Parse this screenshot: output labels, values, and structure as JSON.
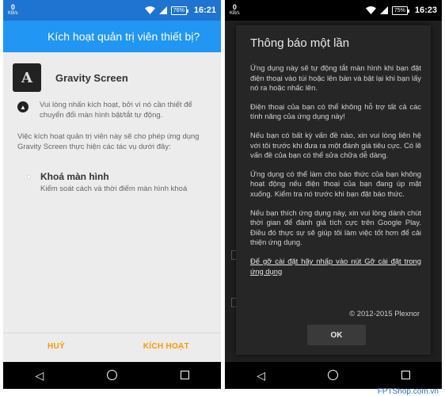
{
  "left": {
    "status": {
      "kbs_value": "0",
      "kbs_unit": "KB/s",
      "battery": "76%",
      "time": "16:21"
    },
    "header": {
      "title": "Kích hoạt quản trị viên thiết bị?"
    },
    "app": {
      "icon_letter": "A",
      "name": "Gravity Screen"
    },
    "info_text": "Vui lòng nhấn kích hoạt, bởi vì nó cần thiết để chuyển đổi màn hình bật/tắt tự động.",
    "description": "Việc kích hoạt quản trị viên này sẽ cho phép ứng dụng Gravity Screen thực hiện các tác vụ dưới đây:",
    "permission": {
      "title": "Khoá màn hình",
      "desc": "Kiểm soát cách và thời điểm màn hình khoá"
    },
    "buttons": {
      "cancel": "HUỶ",
      "activate": "KÍCH HOẠT"
    }
  },
  "right": {
    "status": {
      "kbs_value": "0",
      "kbs_unit": "KB/s",
      "battery": "75%",
      "time": "16:23"
    },
    "dialog": {
      "title": "Thông báo một lần",
      "paragraphs": [
        "Ứng dụng này sẽ tự động tắt màn hình khi bạn đặt điện thoại vào túi hoặc lên bàn và bật lại khi bạn lấy nó ra hoặc nhấc lên.",
        "Điện thoại của bạn có thể không hỗ trợ tất cả các tính năng của ứng dụng này!",
        "Nếu bạn có bất kỳ vấn đề nào, xin vui lòng liên hệ với tôi trước khi đưa ra một đánh giá tiêu cực. Có lẽ vấn đề của bạn có thể sửa chữa dễ dàng.",
        "Ứng dụng có thể làm cho báo thức của bạn không hoạt động nếu điện thoại của bạn đang úp mặt xuống. Kiểm tra nó trước khi bạn đặt báo thức.",
        "Nếu bạn thích ứng dụng này, xin vui lòng dành chút thời gian để đánh giá tích cực trên Google Play. Điều đó thực sự sẽ giúp tôi làm việc tốt hơn để cải thiện ứng dụng."
      ],
      "link": "Để gỡ cài đặt hãy nhấp vào nút Gỡ cài đặt trong ứng dụng",
      "copyright": "© 2012-2015 Plexnor",
      "ok": "OK"
    }
  },
  "icons": {
    "wifi": "wifi-icon",
    "signal": "signal-icon",
    "back": "back-icon",
    "home": "home-icon",
    "recent": "recent-apps-icon"
  },
  "colors": {
    "appbar": "#2196f3",
    "statusbar_left": "#1e74d0",
    "button_accent": "#ff9800",
    "dialog_bg": "#262626"
  },
  "watermark": "FPTShop.com.vn"
}
